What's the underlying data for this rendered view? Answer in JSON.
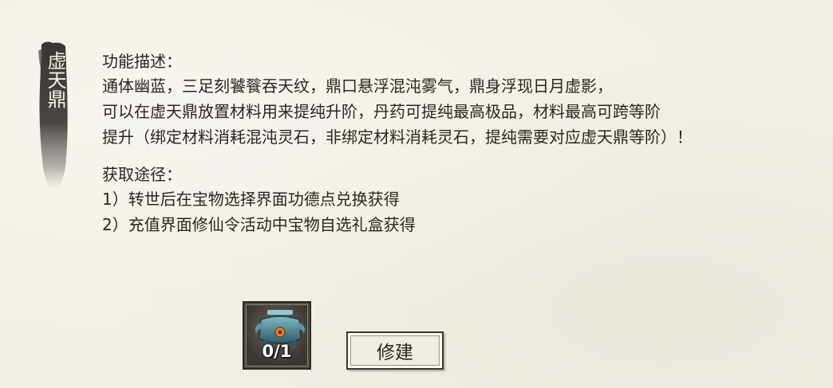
{
  "side_title": "虚天鼎",
  "function_heading": "功能描述：",
  "function_lines": [
    "通体幽蓝，三足刻饕餮吞天纹，鼎口悬浮混沌雾气，鼎身浮现日月虚影，",
    "可以在虚天鼎放置材料用来提纯升阶，丹药可提纯最高极品，材料最高可跨等阶",
    "提升（绑定材料消耗混沌灵石，非绑定材料消耗灵石，提纯需要对应虚天鼎等阶）！"
  ],
  "acquire_heading": "获取途径：",
  "acquire_lines": [
    "1）转世后在宝物选择界面功德点兑换获得",
    "2）充值界面修仙令活动中宝物自选礼盒获得"
  ],
  "item": {
    "icon": "cauldron-icon",
    "count": "0/1"
  },
  "build_button": "修建"
}
